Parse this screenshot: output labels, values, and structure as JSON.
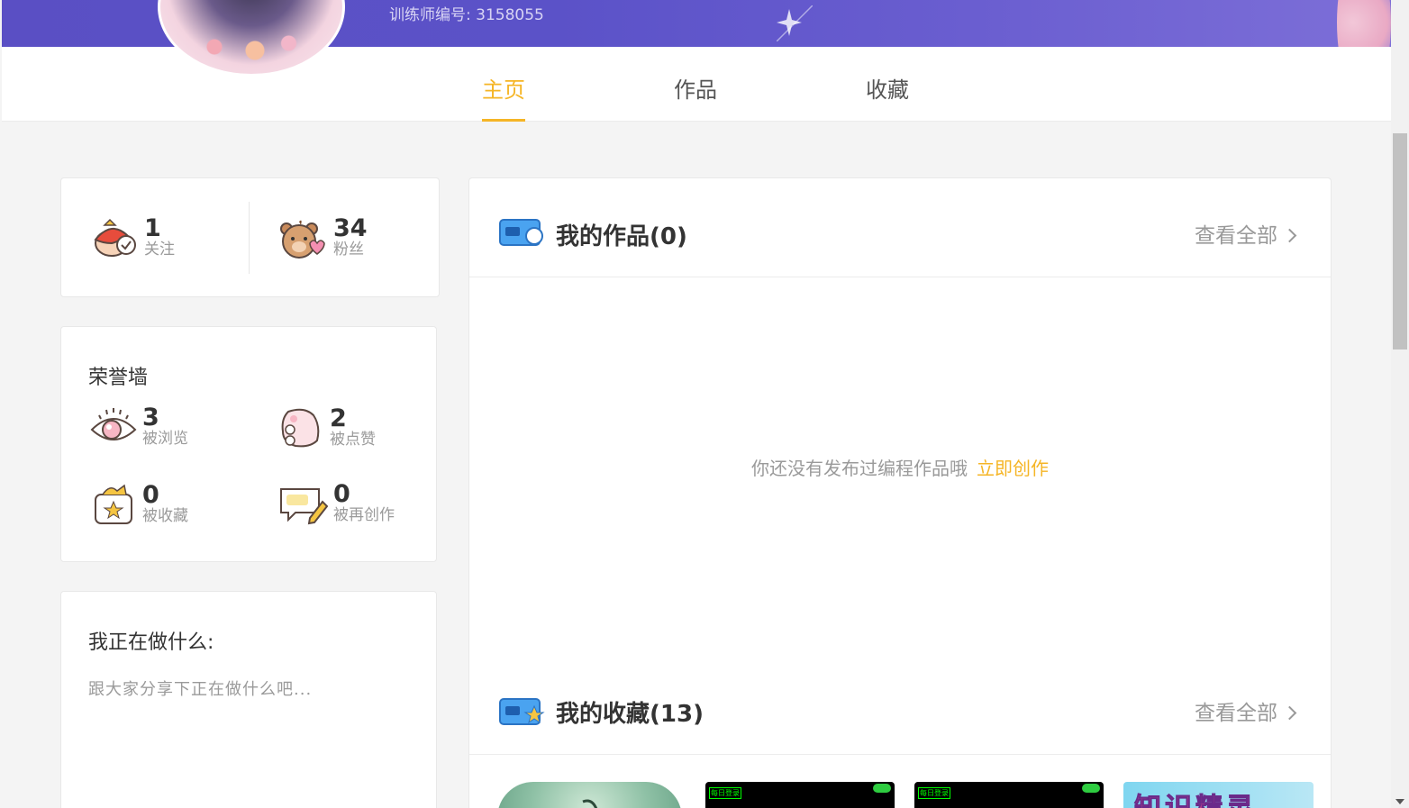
{
  "header": {
    "trainer_id": "训练师编号: 3158055"
  },
  "tabs": [
    {
      "label": "主页",
      "active": true
    },
    {
      "label": "作品",
      "active": false
    },
    {
      "label": "收藏",
      "active": false
    }
  ],
  "follow_stats": {
    "following": {
      "value": "1",
      "label": "关注"
    },
    "fans": {
      "value": "34",
      "label": "粉丝"
    }
  },
  "honor": {
    "title": "荣誉墙",
    "views": {
      "value": "3",
      "label": "被浏览"
    },
    "likes": {
      "value": "2",
      "label": "被点赞"
    },
    "collected": {
      "value": "0",
      "label": "被收藏"
    },
    "remixed": {
      "value": "0",
      "label": "被再创作"
    }
  },
  "status": {
    "title": "我正在做什么:",
    "placeholder": "跟大家分享下正在做什么吧..."
  },
  "my_works": {
    "title": "我的作品(0)",
    "more": "查看全部",
    "empty_text": "你还没有发布过编程作品哦",
    "create_link": "立即创作"
  },
  "my_collections": {
    "title": "我的收藏(13)",
    "more": "查看全部"
  },
  "thumbnails": {
    "labels": [
      "每日登录",
      "每日登录"
    ],
    "fourth_title": "知识精灵"
  },
  "colors": {
    "accent": "#f5b526",
    "banner": "#5a4fc4"
  }
}
